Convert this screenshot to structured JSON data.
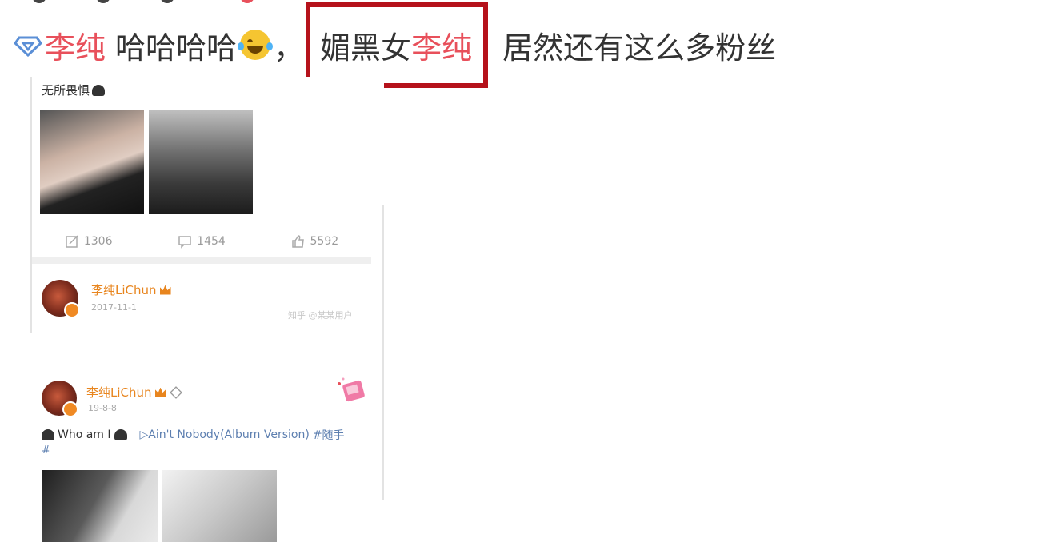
{
  "headline": {
    "user_name": "李纯",
    "laugh_text": "哈哈哈哈",
    "comma": "，",
    "boxed_prefix": "媚黑女",
    "boxed_name": "李纯",
    "rest_text": "居然还有这么多粉丝"
  },
  "embedded_post": {
    "caption": "无所畏惧",
    "actions": {
      "repost_count": "1306",
      "comment_count": "1454",
      "like_count": "5592"
    },
    "post1": {
      "user_name": "李纯LiChun",
      "date": "2017-11-1",
      "source": "知乎 @某某用户"
    },
    "post2": {
      "user_name": "李纯LiChun",
      "date": "19-8-8",
      "text_start": "Who am I",
      "music_link": "▷Ain't Nobody(Album Version)",
      "hashtag_start": "#随手",
      "hashtag_end": "#"
    }
  },
  "colors": {
    "highlight_red": "#e8505b",
    "box_border": "#b5121b",
    "username_orange": "#e8851e",
    "link_blue": "#5d7fb0"
  }
}
